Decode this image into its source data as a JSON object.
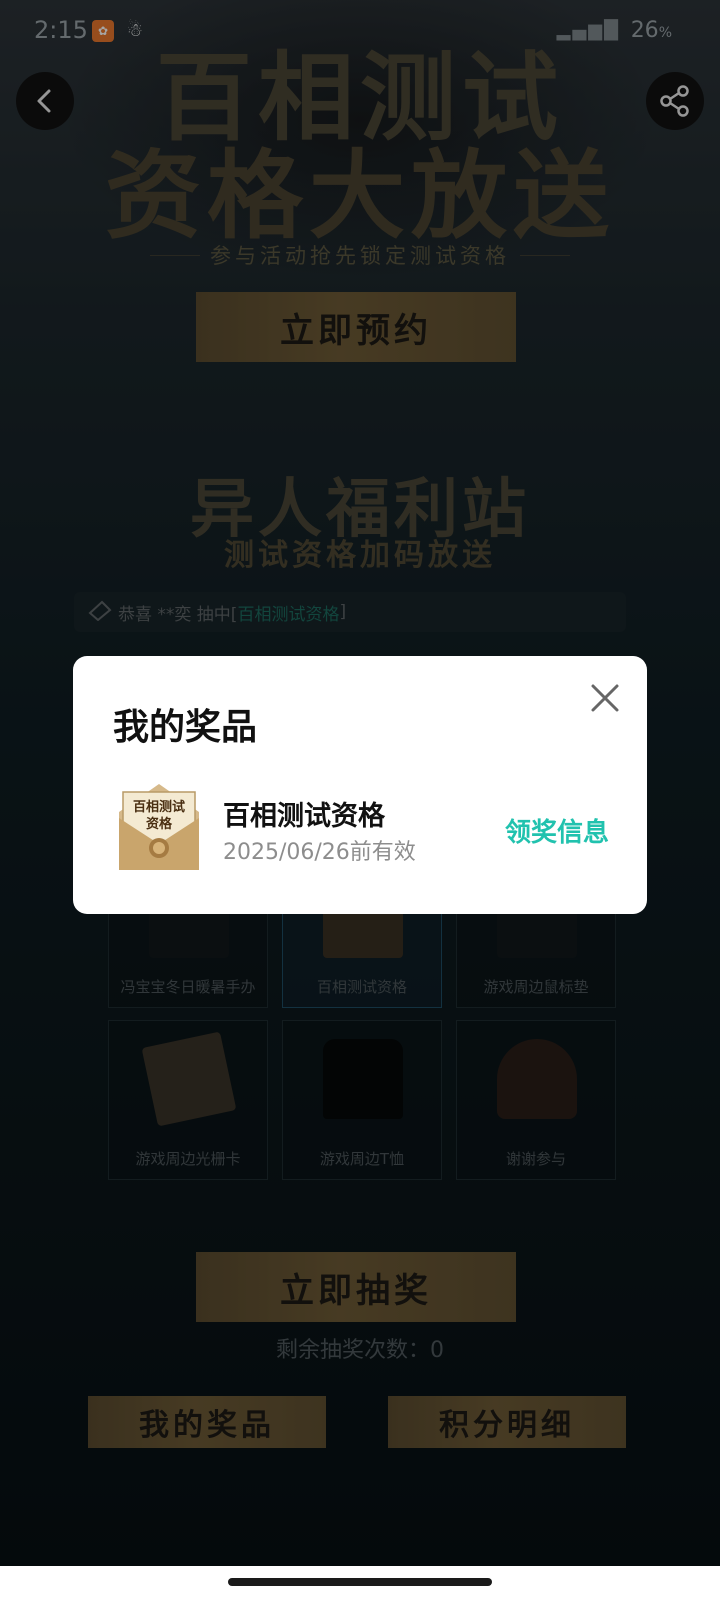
{
  "status_bar": {
    "time": "2:15",
    "battery": "26",
    "battery_unit": "%"
  },
  "hero": {
    "title_line1": "百相测试",
    "title_line2": "资格大放送",
    "subtitle": "参与活动抢先锁定测试资格",
    "reserve_label": "立即预约"
  },
  "welfare": {
    "title": "异人福利站",
    "subtitle": "测试资格加码放送",
    "notice": {
      "prefix": "恭喜 **奕 抽中[",
      "prize": "百相测试资格",
      "suffix": "]"
    }
  },
  "prize_grid": [
    {
      "label": "冯宝宝冬日暖暑手办",
      "art": "bike-figure",
      "selected": false
    },
    {
      "label": "百相测试资格",
      "art": "envelope",
      "selected": true
    },
    {
      "label": "游戏周边鼠标垫",
      "art": "mousepad",
      "selected": false
    },
    {
      "label": "游戏周边光栅卡",
      "art": "cards",
      "selected": false
    },
    {
      "label": "游戏周边T恤",
      "art": "tshirt",
      "selected": false
    },
    {
      "label": "谢谢参与",
      "art": "figure",
      "selected": false
    }
  ],
  "draw": {
    "draw_label": "立即抽奖",
    "remaining_label": "剩余抽奖次数：",
    "remaining_count": "0"
  },
  "bottom_buttons": {
    "my_prizes": "我的奖品",
    "points_detail": "积分明细"
  },
  "modal": {
    "title": "我的奖品",
    "prize": {
      "thumb_line1": "百相测试",
      "thumb_line2": "资格",
      "name": "百相测试资格",
      "validity": "2025/06/26前有效"
    },
    "claim_label": "领奖信息"
  },
  "colors": {
    "accent_teal": "#21c2ae",
    "gold": "#6d5a36"
  }
}
